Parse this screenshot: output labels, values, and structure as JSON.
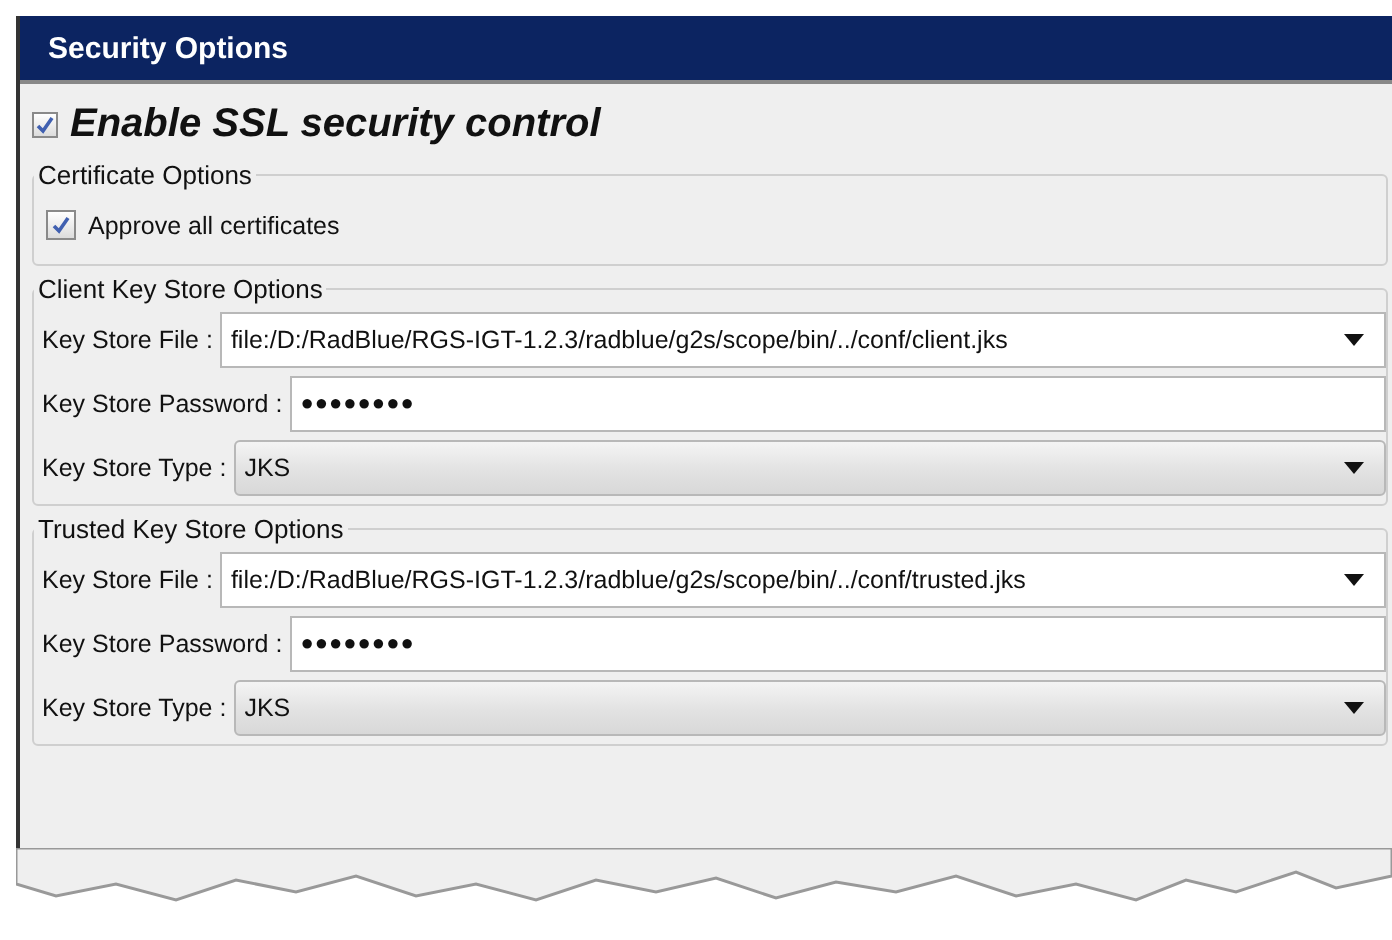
{
  "panel": {
    "title": "Security Options"
  },
  "enable_ssl": {
    "label": "Enable SSL security control",
    "checked": true
  },
  "certificate_options": {
    "title": "Certificate Options",
    "approve": {
      "label": "Approve all certificates",
      "checked": true
    }
  },
  "key_stores": [
    {
      "title": "Client Key Store Options",
      "fields": [
        {
          "kind": "combo",
          "label": "Key Store File :",
          "value": "file:/D:/RadBlue/RGS-IGT-1.2.3/radblue/g2s/scope/bin/../conf/client.jks"
        },
        {
          "kind": "password",
          "label": "Key Store Password :",
          "value": "●●●●●●●●"
        },
        {
          "kind": "select",
          "label": "Key Store Type :",
          "value": "JKS"
        }
      ]
    },
    {
      "title": "Trusted Key Store Options",
      "fields": [
        {
          "kind": "combo",
          "label": "Key Store File :",
          "value": "file:/D:/RadBlue/RGS-IGT-1.2.3/radblue/g2s/scope/bin/../conf/trusted.jks"
        },
        {
          "kind": "password",
          "label": "Key Store Password :",
          "value": "●●●●●●●●"
        },
        {
          "kind": "select",
          "label": "Key Store Type :",
          "value": "JKS"
        }
      ]
    }
  ]
}
